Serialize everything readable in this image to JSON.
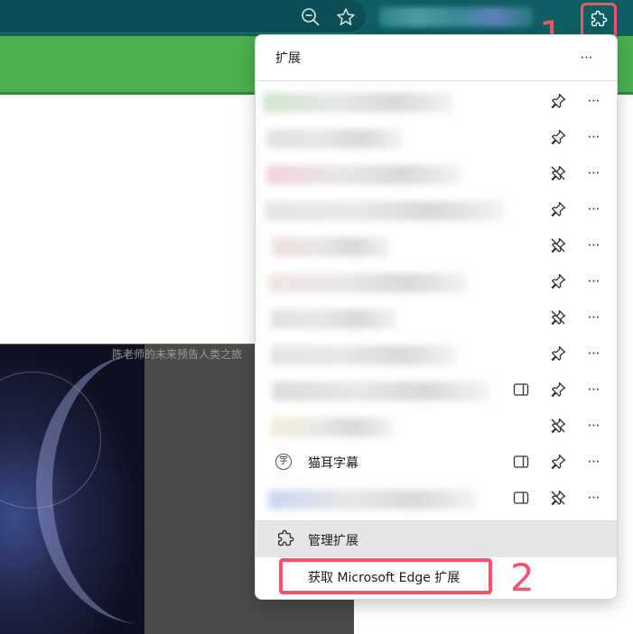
{
  "toolbar": {
    "icons": [
      "zoom-out-icon",
      "favorite-star-icon",
      "extensions-puzzle-icon"
    ]
  },
  "video": {
    "caption": "陈老师的未来预告人类之旅"
  },
  "extensions_panel": {
    "title": "扩展",
    "more_icon": "⋯",
    "items": [
      {
        "name": "",
        "blurred": true,
        "pinned": true,
        "sidebar": false
      },
      {
        "name": "",
        "blurred": true,
        "pinned": true,
        "sidebar": false
      },
      {
        "name": "",
        "blurred": true,
        "pinned": false,
        "sidebar": false
      },
      {
        "name": "",
        "blurred": true,
        "pinned": true,
        "sidebar": false
      },
      {
        "name": "",
        "blurred": true,
        "pinned": false,
        "sidebar": false
      },
      {
        "name": "",
        "blurred": true,
        "pinned": true,
        "sidebar": false
      },
      {
        "name": "",
        "blurred": true,
        "pinned": false,
        "sidebar": false
      },
      {
        "name": "",
        "blurred": true,
        "pinned": true,
        "sidebar": false
      },
      {
        "name": "",
        "blurred": true,
        "pinned": true,
        "sidebar": true
      },
      {
        "name": "",
        "blurred": true,
        "pinned": false,
        "sidebar": false
      },
      {
        "name": "猫耳字幕",
        "icon_glyph": "字",
        "blurred": false,
        "pinned": true,
        "sidebar": true
      },
      {
        "name": "",
        "blurred": true,
        "pinned": false,
        "sidebar": true
      }
    ],
    "manage_label": "管理扩展",
    "get_label": "获取 Microsoft Edge 扩展"
  },
  "annotations": {
    "step1": "1",
    "step2": "2"
  },
  "colors": {
    "chrome": "#0e5e63",
    "green_band": "#4caf50",
    "highlight": "#f0566a",
    "manage_bg": "#e6e6e6"
  }
}
